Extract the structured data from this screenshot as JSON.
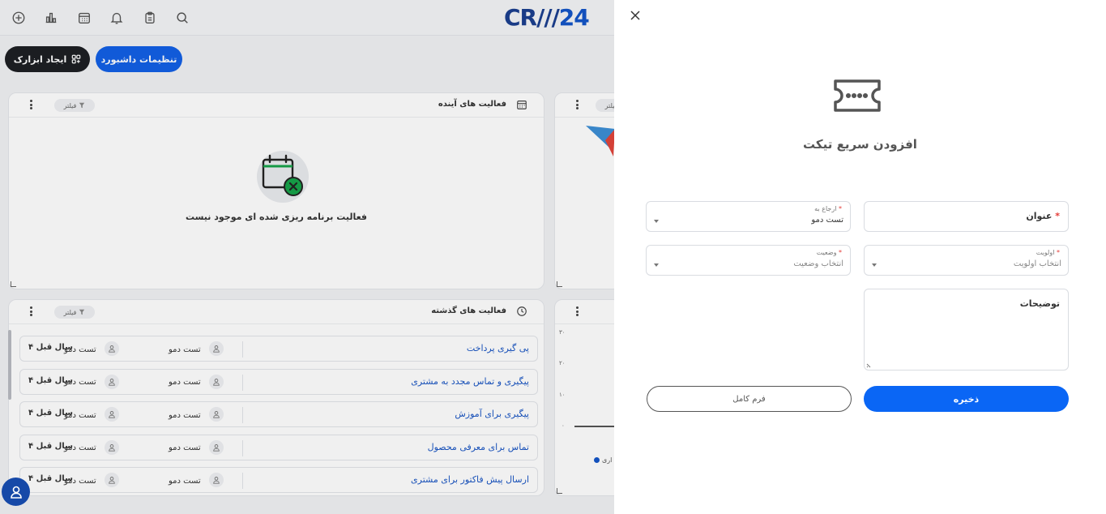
{
  "app": {
    "logo_prefix": "CR",
    "logo_suffix": "24"
  },
  "toolbar": {
    "icons": [
      "add-icon",
      "bar-chart-icon",
      "calendar-icon",
      "bell-icon",
      "clipboard-icon",
      "search-icon"
    ],
    "create_widget_label": "ایجاد ابزارک",
    "dashboard_settings_label": "تنظیمات داشبورد"
  },
  "upcoming_card": {
    "title": "فعالیت های آینده",
    "filter_label": "فیلتر",
    "empty_text": "فعالیت برنامه ریزی شده ای موجود نیست"
  },
  "right_card_top": {
    "filter_label": "فیلتر"
  },
  "past_card": {
    "title": "فعالیت های گذشته",
    "filter_label": "فیلتر",
    "rows": [
      {
        "title": "پی گیری پرداخت",
        "person1": "تست دمو",
        "person2": "تست دمو",
        "time": "۴ سال قبل"
      },
      {
        "title": "پیگیری و تماس مجدد به مشتری",
        "person1": "تست دمو",
        "person2": "تست دمو",
        "time": "۴ سال قبل"
      },
      {
        "title": "پیگیری برای آموزش",
        "person1": "تست دمو",
        "person2": "تست دمو",
        "time": "۴ سال قبل"
      },
      {
        "title": "تماس برای معرفی محصول",
        "person1": "تست دمو",
        "person2": "تست دمو",
        "time": "۴ سال قبل"
      },
      {
        "title": "ارسال پیش فاکتور برای مشتری",
        "person1": "تست دمو",
        "person2": "تست دمو",
        "time": "۴ سال قبل"
      }
    ]
  },
  "right_card_bottom": {
    "y_ticks": [
      "۳۰",
      "۲۰",
      "۱۰",
      "۰"
    ],
    "legend_fragment": "اری"
  },
  "drawer": {
    "title": "افزودن سریع تیکت",
    "fields": {
      "title": {
        "label": "عنوان",
        "required": "*"
      },
      "refer_to": {
        "label": "ارجاع به",
        "required": "*",
        "value": "تست دمو"
      },
      "priority": {
        "label": "اولویت",
        "required": "*",
        "placeholder": "انتخاب اولویت"
      },
      "status": {
        "label": "وضعیت",
        "required": "*",
        "placeholder": "انتخاب وضعیت"
      },
      "description": {
        "label": "توضیحات"
      }
    },
    "save_label": "ذخیره",
    "full_form_label": "فرم کامل"
  },
  "colors": {
    "primary": "#0a66f5",
    "brand": "#1456c8",
    "dark_button": "#1d1f24",
    "required": "#e53935"
  }
}
